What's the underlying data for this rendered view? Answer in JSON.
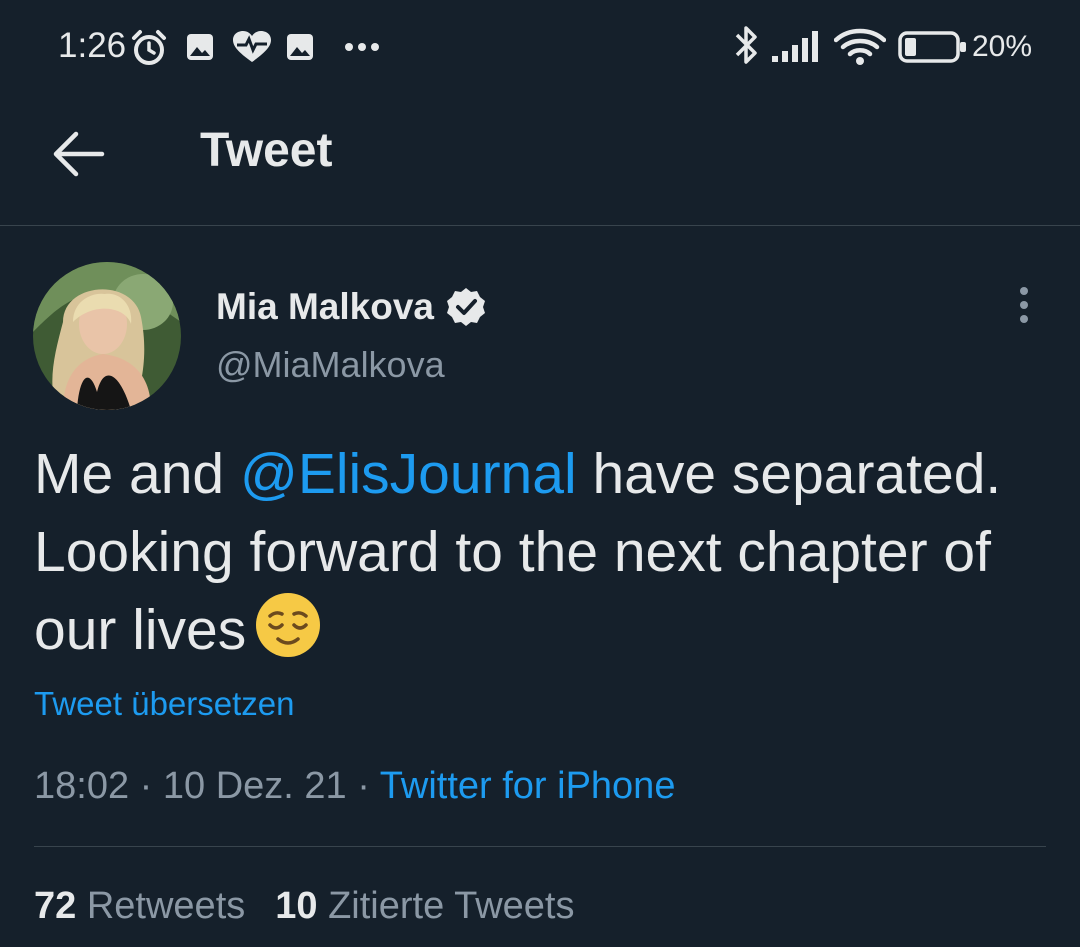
{
  "status_bar": {
    "time": "1:26",
    "battery": "20%",
    "icons": [
      "alarm-icon",
      "image-icon",
      "heart-pulse-icon",
      "image-icon",
      "more-dots-icon",
      "bluetooth-icon",
      "signal-icon",
      "wifi-icon",
      "battery-icon"
    ]
  },
  "header": {
    "title": "Tweet",
    "back_icon": "back-arrow-icon"
  },
  "tweet": {
    "author_name": "Mia Malkova",
    "author_handle": "@MiaMalkova",
    "verified": true,
    "text_before": "Me and ",
    "mention": "@ElisJournal",
    "text_after": " have separated. Looking forward to the next chapter of our lives",
    "emoji": "relieved-face-emoji",
    "translate_label": "Tweet übersetzen",
    "time": "18:02",
    "date": "10 Dez. 21",
    "source": "Twitter for iPhone",
    "separator": " · "
  },
  "stats": {
    "retweets_count": "72",
    "retweets_label": "Retweets",
    "quotes_count": "10",
    "quotes_label": "Zitierte Tweets"
  },
  "colors": {
    "background": "#15202b",
    "accent": "#1d9bf0",
    "text": "#e7e9ea",
    "secondary": "#8b98a5"
  }
}
